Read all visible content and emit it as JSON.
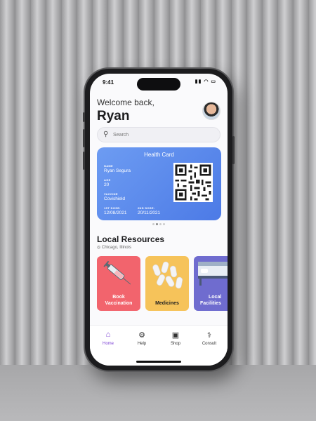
{
  "status": {
    "time": "9:41",
    "icons": "▮▮ ◠ ▭"
  },
  "header": {
    "greeting": "Welcome back,",
    "name": "Ryan"
  },
  "search": {
    "placeholder": "Search",
    "icon": "search-icon"
  },
  "health_card": {
    "title": "Health Card",
    "name_label": "NAME",
    "name": "Ryan Segura",
    "age_label": "AGE",
    "age": "20",
    "vaccine_label": "VACCINE",
    "vaccine": "Covishield",
    "dose1_label": "1ST DOSE:",
    "dose1": "12/08/2021",
    "dose2_label": "2ND DOSE:",
    "dose2": "20/11/2021"
  },
  "resources": {
    "title": "Local Resources",
    "location": "Chicago, Illinois",
    "tiles": [
      {
        "label_line1": "Book",
        "label_line2": "Vaccination",
        "color": "#f2646d"
      },
      {
        "label_line1": "",
        "label_line2": "Medicines",
        "color": "#f6c35a"
      },
      {
        "label_line1": "Local",
        "label_line2": "Facilities",
        "color": "#6f6ccf"
      }
    ]
  },
  "nav": [
    {
      "label": "Home",
      "icon": "home-icon"
    },
    {
      "label": "Help",
      "icon": "gear-icon"
    },
    {
      "label": "Shop",
      "icon": "bag-icon"
    },
    {
      "label": "Consult",
      "icon": "stethoscope-icon"
    }
  ],
  "colors": {
    "accent": "#7b3fd4",
    "card": "#5b8aeb"
  }
}
